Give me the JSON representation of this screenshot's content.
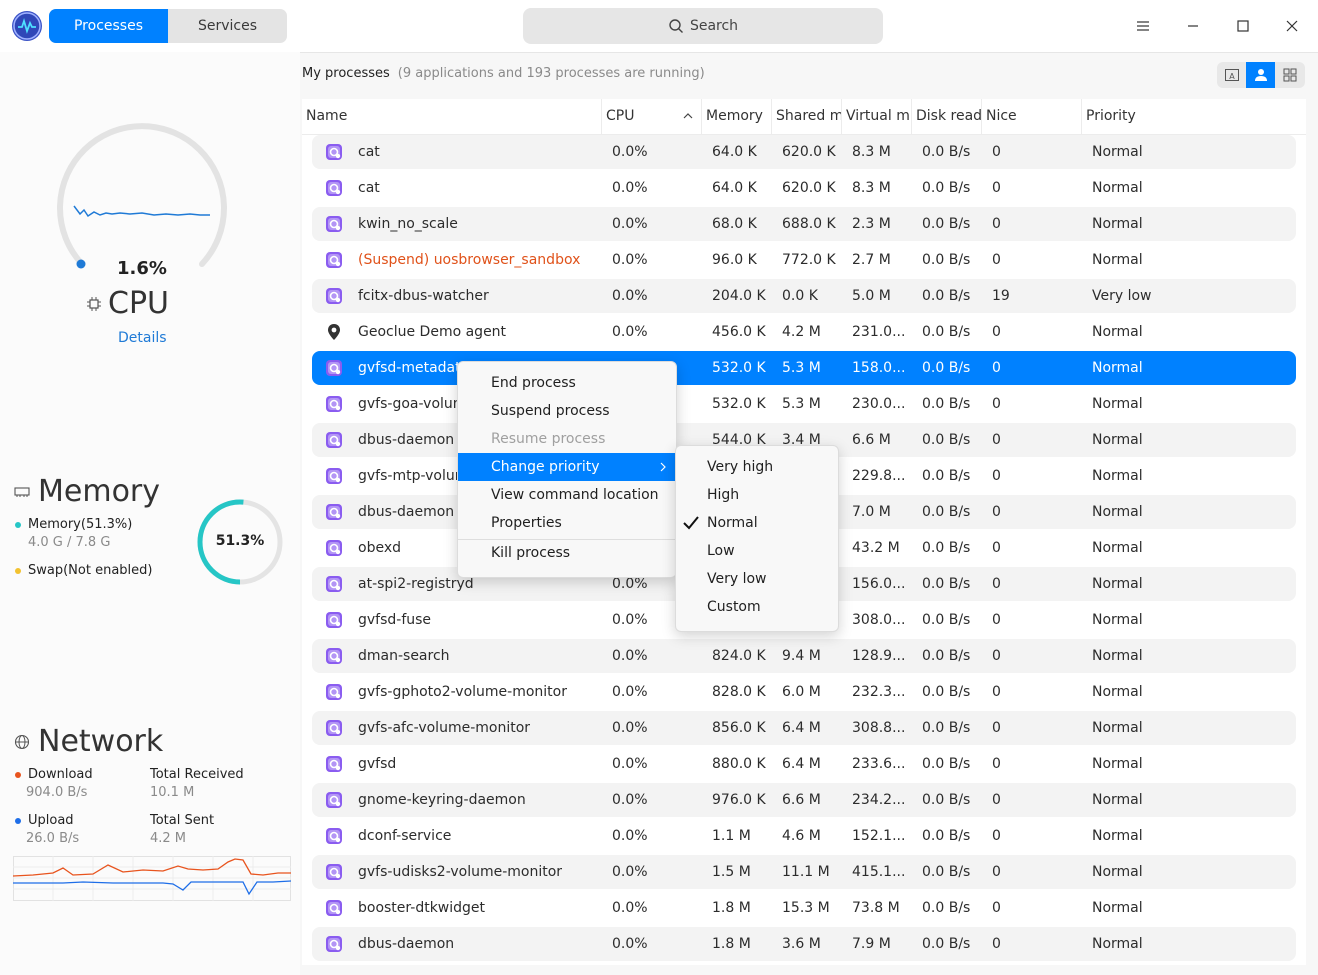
{
  "titlebar": {
    "tabs": [
      {
        "label": "Processes",
        "active": true
      },
      {
        "label": "Services",
        "active": false
      }
    ],
    "search_placeholder": "Search",
    "accent_color": "#0081ff"
  },
  "sidebar": {
    "cpu": {
      "percent": "1.6%",
      "title": "CPU",
      "details_label": "Details",
      "usage_fraction": 0.016
    },
    "memory": {
      "title": "Memory",
      "memory_label": "Memory(51.3%)",
      "memory_sub": "4.0 G / 7.8 G",
      "swap_label": "Swap(Not enabled)",
      "ring_percent": "51.3%",
      "ring_fraction": 0.513,
      "memory_color": "#26c6c6",
      "swap_color": "#f2c230"
    },
    "network": {
      "title": "Network",
      "download_label": "Download",
      "download_value": "904.0 B/s",
      "total_received_label": "Total Received",
      "total_received_value": "10.1 M",
      "upload_label": "Upload",
      "upload_value": "26.0 B/s",
      "total_sent_label": "Total Sent",
      "total_sent_value": "4.2 M",
      "download_color": "#e8541e",
      "upload_color": "#1e6ee8"
    }
  },
  "main": {
    "heading": "My processes",
    "summary": "(9 applications and 193 processes are running)",
    "columns": [
      "Name",
      "CPU",
      "Memory",
      "Shared m",
      "Virtual m",
      "Disk read",
      "Nice",
      "Priority"
    ],
    "rows": [
      {
        "name": "cat",
        "cpu": "0.0%",
        "memory": "64.0 K",
        "shared": "620.0 K",
        "virtual": "8.3 M",
        "disk": "0.0 B/s",
        "nice": "0",
        "priority": "Normal"
      },
      {
        "name": "cat",
        "cpu": "0.0%",
        "memory": "64.0 K",
        "shared": "620.0 K",
        "virtual": "8.3 M",
        "disk": "0.0 B/s",
        "nice": "0",
        "priority": "Normal"
      },
      {
        "name": "kwin_no_scale",
        "cpu": "0.0%",
        "memory": "68.0 K",
        "shared": "688.0 K",
        "virtual": "2.3 M",
        "disk": "0.0 B/s",
        "nice": "0",
        "priority": "Normal"
      },
      {
        "name": "(Suspend) uosbrowser_sandbox",
        "cpu": "0.0%",
        "memory": "96.0 K",
        "shared": "772.0 K",
        "virtual": "2.7 M",
        "disk": "0.0 B/s",
        "nice": "0",
        "priority": "Normal",
        "suspended": true
      },
      {
        "name": "fcitx-dbus-watcher",
        "cpu": "0.0%",
        "memory": "204.0 K",
        "shared": "0.0 K",
        "virtual": "5.0 M",
        "disk": "0.0 B/s",
        "nice": "19",
        "priority": "Very low"
      },
      {
        "name": "Geoclue Demo agent",
        "cpu": "0.0%",
        "memory": "456.0 K",
        "shared": "4.2 M",
        "virtual": "231.0...",
        "disk": "0.0 B/s",
        "nice": "0",
        "priority": "Normal",
        "icon": "location-pin-icon"
      },
      {
        "name": "gvfsd-metadata",
        "cpu": "",
        "memory": "532.0 K",
        "shared": "5.3 M",
        "virtual": "158.0...",
        "disk": "0.0 B/s",
        "nice": "0",
        "priority": "Normal",
        "selected": true
      },
      {
        "name": "gvfs-goa-volum",
        "cpu": "",
        "memory": "532.0 K",
        "shared": "5.3 M",
        "virtual": "230.0...",
        "disk": "0.0 B/s",
        "nice": "0",
        "priority": "Normal"
      },
      {
        "name": "dbus-daemon",
        "cpu": "",
        "memory": "544.0 K",
        "shared": "3.4 M",
        "virtual": "6.6 M",
        "disk": "0.0 B/s",
        "nice": "0",
        "priority": "Normal"
      },
      {
        "name": "gvfs-mtp-volum",
        "cpu": "",
        "memory": "",
        "shared": "",
        "virtual": "229.8...",
        "disk": "0.0 B/s",
        "nice": "0",
        "priority": "Normal"
      },
      {
        "name": "dbus-daemon",
        "cpu": "",
        "memory": "",
        "shared": "",
        "virtual": "7.0 M",
        "disk": "0.0 B/s",
        "nice": "0",
        "priority": "Normal"
      },
      {
        "name": "obexd",
        "cpu": "",
        "memory": "",
        "shared": "",
        "virtual": "43.2 M",
        "disk": "0.0 B/s",
        "nice": "0",
        "priority": "Normal"
      },
      {
        "name": "at-spi2-registryd",
        "cpu": "0.0%",
        "memory": "",
        "shared": "",
        "virtual": "156.0...",
        "disk": "0.0 B/s",
        "nice": "0",
        "priority": "Normal"
      },
      {
        "name": "gvfsd-fuse",
        "cpu": "0.0%",
        "memory": "",
        "shared": "",
        "virtual": "308.0...",
        "disk": "0.0 B/s",
        "nice": "0",
        "priority": "Normal"
      },
      {
        "name": "dman-search",
        "cpu": "0.0%",
        "memory": "824.0 K",
        "shared": "9.4 M",
        "virtual": "128.9...",
        "disk": "0.0 B/s",
        "nice": "0",
        "priority": "Normal"
      },
      {
        "name": "gvfs-gphoto2-volume-monitor",
        "cpu": "0.0%",
        "memory": "828.0 K",
        "shared": "6.0 M",
        "virtual": "232.3...",
        "disk": "0.0 B/s",
        "nice": "0",
        "priority": "Normal"
      },
      {
        "name": "gvfs-afc-volume-monitor",
        "cpu": "0.0%",
        "memory": "856.0 K",
        "shared": "6.4 M",
        "virtual": "308.8...",
        "disk": "0.0 B/s",
        "nice": "0",
        "priority": "Normal"
      },
      {
        "name": "gvfsd",
        "cpu": "0.0%",
        "memory": "880.0 K",
        "shared": "6.4 M",
        "virtual": "233.6...",
        "disk": "0.0 B/s",
        "nice": "0",
        "priority": "Normal"
      },
      {
        "name": "gnome-keyring-daemon",
        "cpu": "0.0%",
        "memory": "976.0 K",
        "shared": "6.6 M",
        "virtual": "234.2...",
        "disk": "0.0 B/s",
        "nice": "0",
        "priority": "Normal"
      },
      {
        "name": "dconf-service",
        "cpu": "0.0%",
        "memory": "1.1 M",
        "shared": "4.6 M",
        "virtual": "152.1...",
        "disk": "0.0 B/s",
        "nice": "0",
        "priority": "Normal"
      },
      {
        "name": "gvfs-udisks2-volume-monitor",
        "cpu": "0.0%",
        "memory": "1.5 M",
        "shared": "11.1 M",
        "virtual": "415.1...",
        "disk": "0.0 B/s",
        "nice": "0",
        "priority": "Normal"
      },
      {
        "name": "booster-dtkwidget",
        "cpu": "0.0%",
        "memory": "1.8 M",
        "shared": "15.3 M",
        "virtual": "73.8 M",
        "disk": "0.0 B/s",
        "nice": "0",
        "priority": "Normal"
      },
      {
        "name": "dbus-daemon",
        "cpu": "0.0%",
        "memory": "1.8 M",
        "shared": "3.6 M",
        "virtual": "7.9 M",
        "disk": "0.0 B/s",
        "nice": "0",
        "priority": "Normal"
      }
    ]
  },
  "context_menu": {
    "items": [
      "End process",
      "Suspend process",
      "Resume process",
      "Change priority",
      "View command location",
      "Properties",
      "Kill process"
    ],
    "disabled": [
      "Resume process"
    ],
    "highlighted": "Change priority"
  },
  "priority_submenu": {
    "items": [
      "Very high",
      "High",
      "Normal",
      "Low",
      "Very low",
      "Custom"
    ],
    "checked": "Normal"
  }
}
